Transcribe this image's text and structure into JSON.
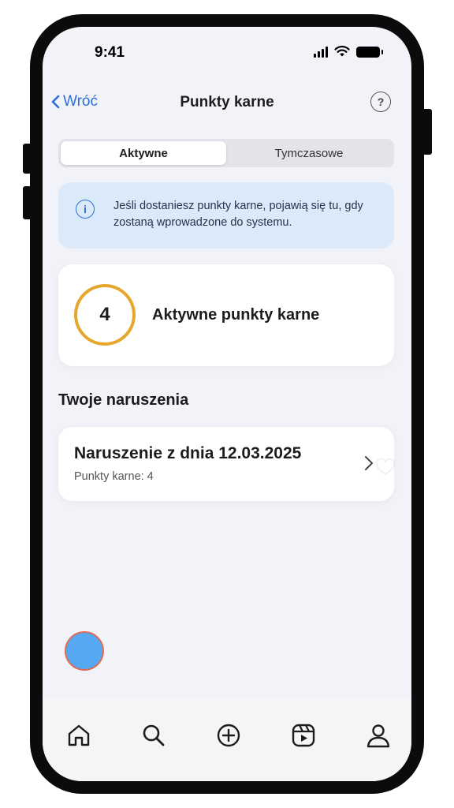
{
  "status_bar": {
    "time": "9:41",
    "icons": [
      "signal-icon",
      "wifi-icon",
      "battery-icon"
    ]
  },
  "nav": {
    "back_label": "Wróć",
    "title": "Punkty karne",
    "help_label": "?"
  },
  "segments": {
    "active": "Aktywne",
    "inactive": "Tymczasowe"
  },
  "info_banner": {
    "icon_label": "i",
    "text": "Jeśli dostaniesz punkty karne, pojawią się tu, gdy zostaną wprowadzone do systemu."
  },
  "points": {
    "value": "4",
    "label": "Aktywne punkty karne",
    "ring_color": "#e5a72b"
  },
  "violations_section": {
    "title": "Twoje naruszenia"
  },
  "violations": [
    {
      "title": "Naruszenie z dnia 12.03.2025",
      "subtitle": "Punkty karne: 4"
    }
  ],
  "tab_bar": {
    "items": [
      "home-icon",
      "search-icon",
      "create-icon",
      "reels-icon",
      "profile-icon"
    ]
  },
  "colors": {
    "accent": "#2f6ed8",
    "info_bg": "#dbeafa",
    "fab": "#57a8f2",
    "fab_border": "#e26a52"
  }
}
